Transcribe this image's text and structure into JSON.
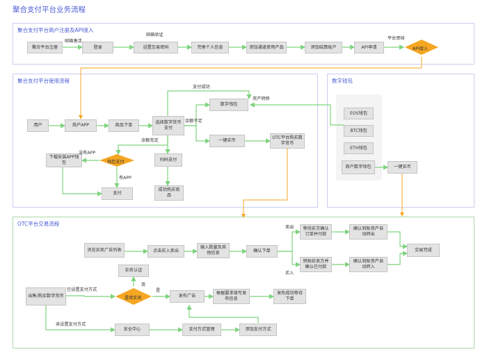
{
  "title": "聚合支付平台业务流程",
  "panels": {
    "register": "聚合支付平台商户注册及API接入",
    "usage": "聚合支付平台使用流程",
    "wallet": "数字钱包",
    "otc": "OTC平台交易流程"
  },
  "nodes": {
    "reg_platform": "聚合平台注册",
    "login": "登录",
    "set_trade_pwd": "设置交易密码",
    "complete_info": "完善个人信息",
    "add_channel": "添加通道使用产品",
    "add_settle": "添加结算账户",
    "api_apply": "API申请",
    "api_access": "API接入",
    "user": "用户",
    "merchant_app": "商户APP",
    "order": "商品下单",
    "choose_pay": "选择数字货币支付",
    "digital_wallet": "数字钱包",
    "one_click_buy": "一键买币",
    "otc_buy": "OTC平台购买数字货币",
    "download_app": "下载安装APP钱包",
    "wallet_pay": "钱包支付",
    "scan_pay": "扫码支付",
    "pay": "支付",
    "buy_success": "成功购买商品",
    "eos": "EOS钱包",
    "btc": "BTC钱包",
    "eth": "ETH钱包",
    "merchant_wallet": "商户数字钱包",
    "wallet_buy": "一键买币",
    "browse_ads": "浏览买卖广告列表",
    "click_trade": "点击买入卖出",
    "input_qty": "输入数量及其他信息",
    "confirm_order": "确认下单",
    "wait_buyer": "等待买方确认订单并付款",
    "confirm_asset_out": "确认到账资产自动转出",
    "transfer_confirm": "转账给卖方并确认已付款",
    "confirm_asset_in": "确认到账资产自动转入",
    "trade_done": "交易完成",
    "sell_buy": "出售/购买数字货币",
    "realname": "实名认证",
    "is_realname": "是否实名",
    "publish_ad": "发布广告",
    "fill_info": "根据要求填写发布信息",
    "publish_ok": "发布成功等待下单",
    "security": "安全中心",
    "pay_method_mgmt": "支付方式管理",
    "add_pay_method": "添加支付方式"
  },
  "labels": {
    "email_activate": "邮箱激活",
    "email_verify": "邮箱验证",
    "platform_review": "平台审核",
    "pay_success": "支付成功",
    "asset_transfer": "资产转移",
    "insufficient": "余额不足",
    "sufficient": "余额充足",
    "no_app": "没有APP",
    "has_app": "有APP",
    "sell": "卖出",
    "buy": "买入",
    "pay_set": "已设置支付方式",
    "no": "否",
    "yes": "是",
    "pay_unset": "未设置支付方式"
  },
  "colors": {
    "title": "#4a5bd6",
    "panel_border": "#c9cdf4",
    "otc_border": "#a8d8a8",
    "node_fill": "#e3e3e3",
    "diamond": "#f5a623",
    "edge": "#7ed37e",
    "cross_edge": "#f5a623"
  }
}
